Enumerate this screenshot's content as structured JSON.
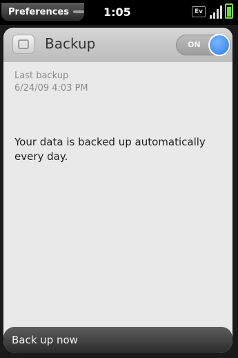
{
  "status_bar": {
    "app_menu_label": "Preferences",
    "time": "1:05",
    "network_badge": "Ev",
    "icons": [
      "signal-icon",
      "battery-icon"
    ]
  },
  "header": {
    "title": "Backup",
    "app_icon": "backup-icon",
    "toggle_label": "ON",
    "toggle_on": true
  },
  "backup_info": {
    "last_backup_label": "Last backup",
    "last_backup_value": "6/24/09 4:03 PM",
    "description": "Your data is backed up automatically every day."
  },
  "actions": {
    "back_up_now_label": "Back up now"
  },
  "colors": {
    "toggle_knob": "#2d7ee5",
    "battery": "#6fd63c"
  }
}
